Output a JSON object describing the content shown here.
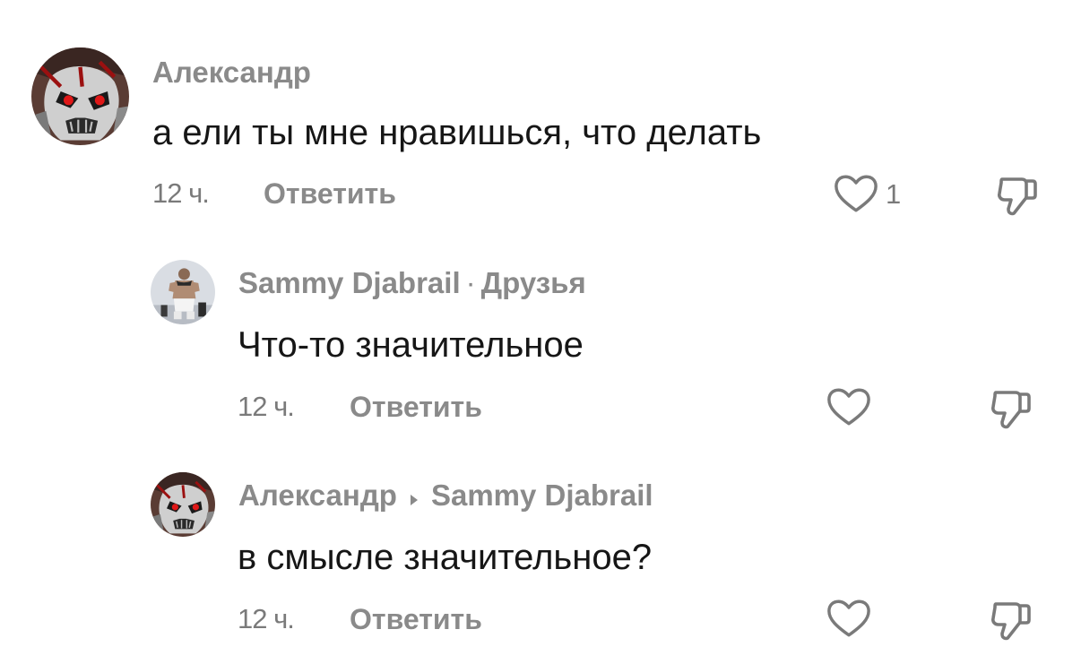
{
  "comments": [
    {
      "author": "Александр",
      "text": "а ели ты мне нравишься, что делать",
      "time": "12 ч.",
      "reply_label": "Ответить",
      "like_count": "1",
      "avatar_icon": "skull-avatar-icon"
    },
    {
      "author": "Sammy Djabrail",
      "separator": "·",
      "badge": "Друзья",
      "text": "Что-то значительное",
      "time": "12 ч.",
      "reply_label": "Ответить",
      "avatar_icon": "person-avatar-icon"
    },
    {
      "author": "Александр",
      "reply_to": "Sammy Djabrail",
      "text": "в смысле значительное?",
      "time": "12 ч.",
      "reply_label": "Ответить",
      "avatar_icon": "skull-avatar-icon"
    }
  ],
  "colors": {
    "text": "#161616",
    "muted": "#8a8a8a",
    "icon": "#7a7a7a"
  },
  "icons": {
    "like": "heart-icon",
    "dislike": "thumbs-down-icon",
    "reply_arrow": "triangle-right-icon"
  }
}
